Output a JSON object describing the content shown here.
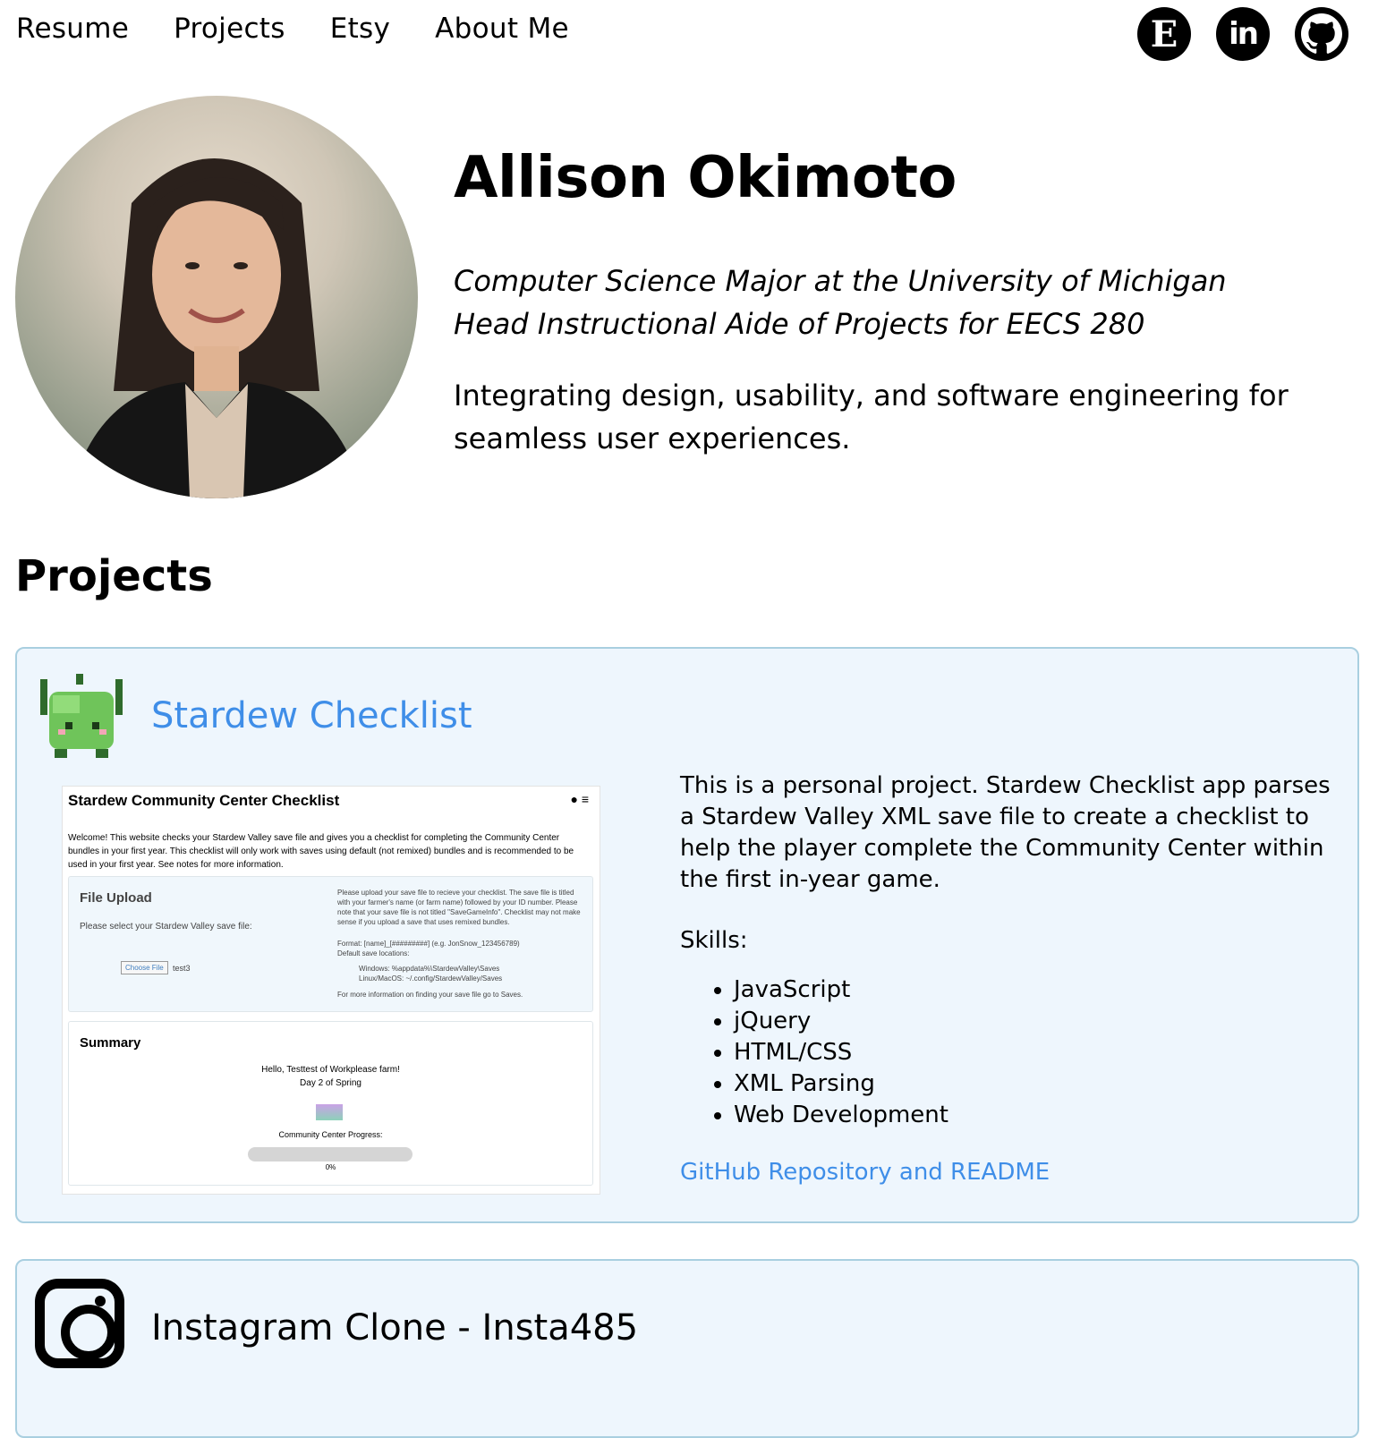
{
  "nav": {
    "items": [
      "Resume",
      "Projects",
      "Etsy",
      "About Me"
    ]
  },
  "socials": {
    "etsy_letter": "E",
    "linkedin_text": "in",
    "icons": [
      "etsy-icon",
      "linkedin-icon",
      "github-icon"
    ]
  },
  "hero": {
    "name": "Allison Okimoto",
    "subtitle_1": "Computer Science Major at the University of Michigan",
    "subtitle_2": "Head Instructional Aide of Projects for EECS 280",
    "tagline": "Integrating design, usability, and software engineering for seamless user experiences."
  },
  "projects_heading": "Projects",
  "project1": {
    "title": "Stardew Checklist",
    "screenshot": {
      "title": "Stardew Community Center Checklist",
      "intro": "Welcome! This website checks your Stardew Valley save file and gives you a checklist for completing the Community Center bundles in your first year. This checklist will only work with saves using default (not remixed) bundles and is recommended to be used in your first year. See notes for more information.",
      "upload_heading": "File Upload",
      "upload_prompt": "Please select your Stardew Valley save file:",
      "choose_file": "Choose File",
      "file_name": "test3",
      "upload_notes": "Please upload your save file to recieve your checklist. The save file is titled with your farmer's name (or farm name) followed by your ID number. Please note that your save file is not titled \"SaveGameInfo\". Checklist may not make sense if you upload a save that uses remixed bundles.",
      "format": "Format: [name]_[#########] (e.g. JonSnow_123456789)",
      "default_locations": "Default save locations:",
      "loc_windows": "Windows: %appdata%\\StardewValley\\Saves",
      "loc_linux": "Linux/MacOS: ~/.config/StardewValley/Saves",
      "more_info": "For more information on finding your save file go to Saves.",
      "summary_heading": "Summary",
      "greeting": "Hello, Testtest of Workplease farm!",
      "day": "Day 2 of Spring",
      "progress_label": "Community Center Progress:",
      "progress_text": "0%",
      "progress_value": 0
    },
    "description": "This is a personal project. Stardew Checklist app parses a Stardew Valley XML save file to create a checklist to help the player complete the Community Center within the first in-year game.",
    "skills_label": "Skills:",
    "skills": [
      "JavaScript",
      "jQuery",
      "HTML/CSS",
      "XML Parsing",
      "Web Development"
    ],
    "repo_link": "GitHub Repository and README"
  },
  "project2": {
    "title": "Instagram Clone - Insta485"
  },
  "colors": {
    "link_blue": "#3f8ee8",
    "card_bg": "#eef6fd",
    "card_border": "#a9cfe0"
  }
}
